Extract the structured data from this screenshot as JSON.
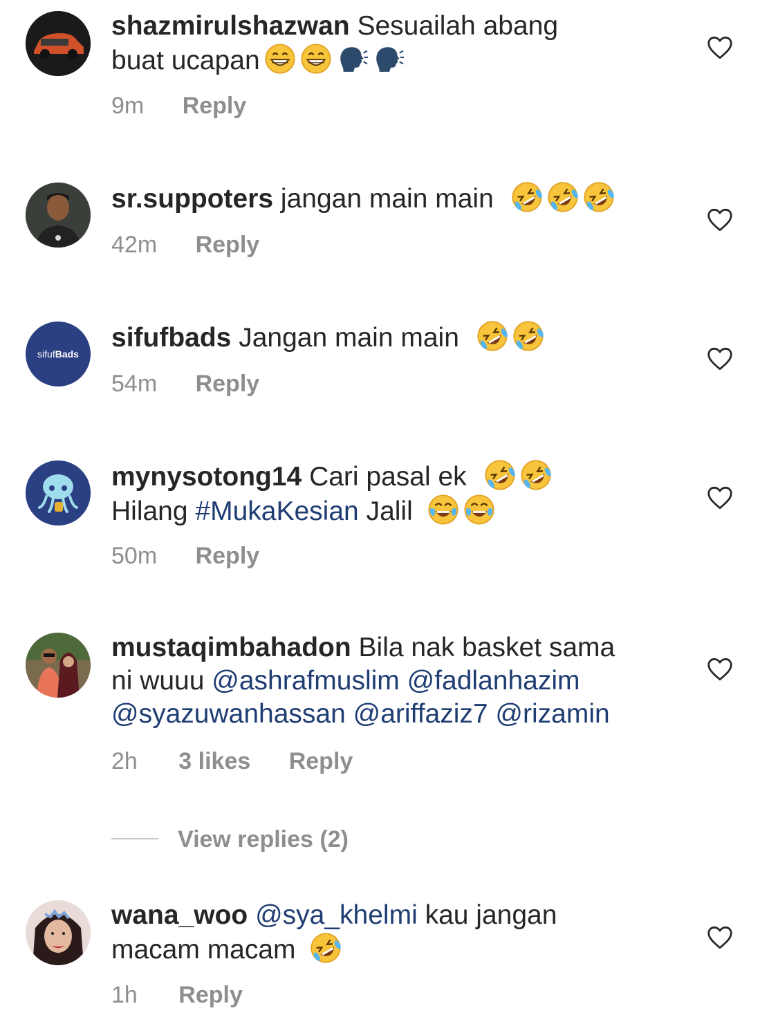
{
  "colors": {
    "mention": "#1f3d73",
    "meta": "#8e8e8e",
    "text": "#262626"
  },
  "comments": [
    {
      "username": "shazmirulshazwan",
      "pre": "Sesuailah abang",
      "line2": "buat ucapan",
      "time": "9m",
      "reply": "Reply",
      "emojis": [
        "grin-emoji",
        "grin-emoji",
        "speaking-head-emoji",
        "speaking-head-emoji"
      ]
    },
    {
      "username": "sr.suppoters",
      "text": "jangan main main",
      "time": "42m",
      "reply": "Reply",
      "emojis": [
        "rofl-emoji",
        "rofl-emoji",
        "rofl-emoji"
      ]
    },
    {
      "username": "sifufbads",
      "text": "Jangan main main",
      "time": "54m",
      "reply": "Reply",
      "avatar_text_a": "sifuf",
      "avatar_text_b": "Bads",
      "emojis": [
        "rofl-emoji",
        "rofl-emoji"
      ]
    },
    {
      "username": "mynysotong14",
      "text": "Cari pasal ek",
      "line2_pre": "Hilang",
      "hashtag": "#MukaKesian",
      "line2_post": "Jalil",
      "time": "50m",
      "reply": "Reply",
      "emojis": [
        "rofl-emoji",
        "rofl-emoji",
        "joy-emoji",
        "joy-emoji"
      ]
    },
    {
      "username": "mustaqimbahadon",
      "text": "Bila nak basket sama",
      "line2_pre": "ni wuuu",
      "mentions": [
        "@ashrafmuslim",
        "@fadlanhazim",
        "@syazuwanhassan",
        "@ariffaziz7",
        "@rizamin"
      ],
      "time": "2h",
      "likes": "3 likes",
      "reply": "Reply"
    },
    {
      "username": "wana_woo",
      "mention": "@sya_khelmi",
      "text": "kau jangan",
      "line2": "macam macam",
      "time": "1h",
      "reply": "Reply",
      "emojis": [
        "rofl-emoji"
      ]
    }
  ],
  "view_replies": "View replies (2)"
}
